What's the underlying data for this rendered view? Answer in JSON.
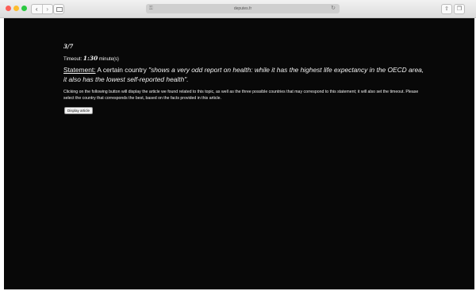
{
  "browser": {
    "address_domain": "deputes.fr",
    "lock_glyph": "⚿",
    "reload_glyph": "↻",
    "back_glyph": "‹",
    "forward_glyph": "›",
    "share_glyph": "⇧",
    "tabs_glyph": "❐"
  },
  "quiz": {
    "counter": "3/7",
    "timeout_label": "Timeout:",
    "timeout_value": "1:30",
    "timeout_unit": "minute(s)",
    "statement_label": "Statement:",
    "statement_intro": " A certain country ",
    "statement_quote": "\"shows a very odd report on health: while it has the highest life expectancy in the OECD area, it also has the lowest self-reported health\".",
    "instructions": "Clicking on the following button will display the article we found related to this topic, as well as the three possible countries that may correspond to this statement; it will also set the timeout. Please select the country that corresponds the best, based on the facts provided in this article.",
    "display_button_label": "Display article"
  }
}
